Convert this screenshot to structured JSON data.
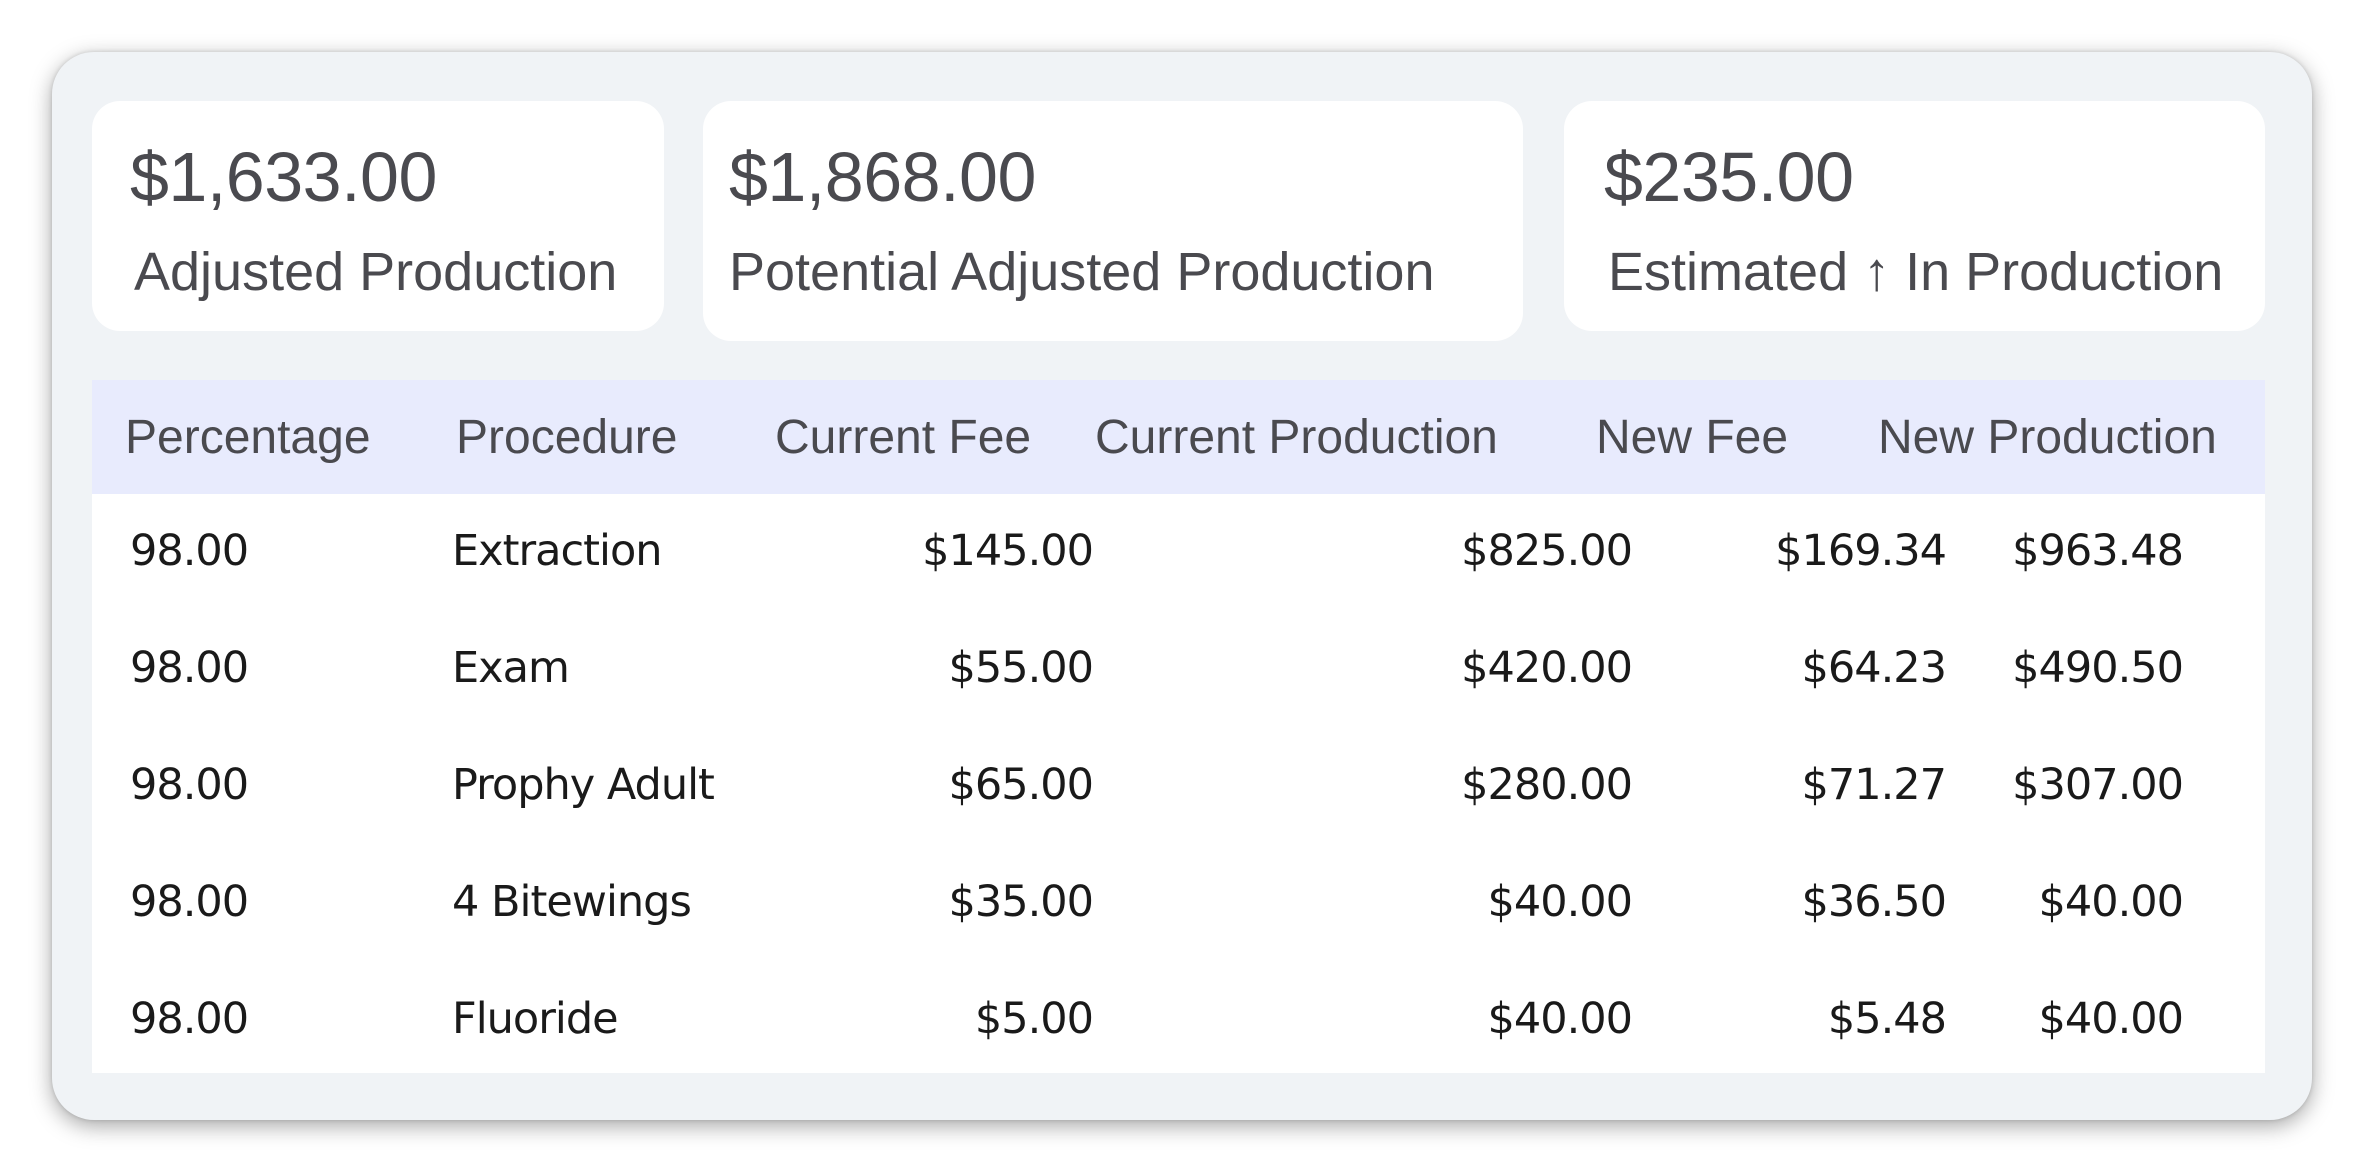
{
  "summary": [
    {
      "amount": "$1,633.00",
      "label": "Adjusted Production"
    },
    {
      "amount": "$1,868.00",
      "label": "Potential Adjusted Production"
    },
    {
      "amount": "$235.00",
      "label": "Estimated ↑ In Production"
    }
  ],
  "table": {
    "headers": [
      "Percentage",
      "Procedure",
      "Current Fee",
      "Current Production",
      "New Fee",
      "New Production"
    ],
    "rows": [
      {
        "percentage": "98.00",
        "procedure": "Extraction",
        "current_fee": "$145.00",
        "current_production": "$825.00",
        "new_fee": "$169.34",
        "new_production": "$963.48"
      },
      {
        "percentage": "98.00",
        "procedure": "Exam",
        "current_fee": "$55.00",
        "current_production": "$420.00",
        "new_fee": "$64.23",
        "new_production": "$490.50"
      },
      {
        "percentage": "98.00",
        "procedure": "Prophy Adult",
        "current_fee": "$65.00",
        "current_production": "$280.00",
        "new_fee": "$71.27",
        "new_production": "$307.00"
      },
      {
        "percentage": "98.00",
        "procedure": "4 Bitewings",
        "current_fee": "$35.00",
        "current_production": "$40.00",
        "new_fee": "$36.50",
        "new_production": "$40.00"
      },
      {
        "percentage": "98.00",
        "procedure": "Fluoride",
        "current_fee": "$5.00",
        "current_production": "$40.00",
        "new_fee": "$5.48",
        "new_production": "$40.00"
      }
    ]
  }
}
